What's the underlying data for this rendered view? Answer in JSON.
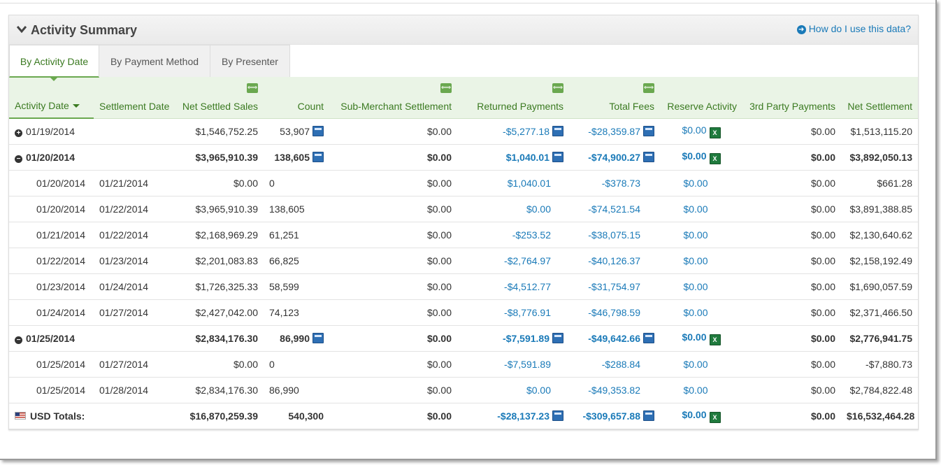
{
  "panel": {
    "title": "Activity Summary",
    "help_link": "How do I use this data?"
  },
  "tabs": [
    {
      "label": "By Activity Date",
      "active": true
    },
    {
      "label": "By Payment Method",
      "active": false
    },
    {
      "label": "By Presenter",
      "active": false
    }
  ],
  "columns": {
    "activity_date": "Activity Date",
    "settlement_date": "Settlement Date",
    "net_settled_sales": "Net Settled Sales",
    "count": "Count",
    "sub_merchant_settlement": "Sub-Merchant Settlement",
    "returned_payments": "Returned Payments",
    "total_fees": "Total Fees",
    "reserve_activity": "Reserve Activity",
    "third_party_payments": "3rd Party Payments",
    "net_settlement": "Net Settlement"
  },
  "rows": [
    {
      "toggle": "+",
      "activity": "01/19/2014",
      "settlement": "",
      "sales": "$1,546,752.25",
      "count": "53,907",
      "sub": "$0.00",
      "returned": "-$5,277.18",
      "fees": "-$28,359.87",
      "reserve": "$0.00",
      "third": "$0.00",
      "net": "$1,513,115.20"
    },
    {
      "toggle": "−",
      "activity": "01/20/2014",
      "settlement": "",
      "sales": "$3,965,910.39",
      "count": "138,605",
      "sub": "$0.00",
      "returned": "$1,040.01",
      "fees": "-$74,900.27",
      "reserve": "$0.00",
      "third": "$0.00",
      "net": "$3,892,050.13"
    },
    {
      "toggle": "",
      "activity": "01/20/2014",
      "settlement": "01/21/2014",
      "sales": "$0.00",
      "count": "0",
      "sub": "$0.00",
      "returned": "$1,040.01",
      "fees": "-$378.73",
      "reserve": "$0.00",
      "third": "$0.00",
      "net": "$661.28"
    },
    {
      "toggle": "",
      "activity": "01/20/2014",
      "settlement": "01/22/2014",
      "sales": "$3,965,910.39",
      "count": "138,605",
      "sub": "$0.00",
      "returned": "$0.00",
      "fees": "-$74,521.54",
      "reserve": "$0.00",
      "third": "$0.00",
      "net": "$3,891,388.85"
    },
    {
      "toggle": "",
      "activity": "01/21/2014",
      "settlement": "01/22/2014",
      "sales": "$2,168,969.29",
      "count": "61,251",
      "sub": "$0.00",
      "returned": "-$253.52",
      "fees": "-$38,075.15",
      "reserve": "$0.00",
      "third": "$0.00",
      "net": "$2,130,640.62"
    },
    {
      "toggle": "",
      "activity": "01/22/2014",
      "settlement": "01/23/2014",
      "sales": "$2,201,083.83",
      "count": "66,825",
      "sub": "$0.00",
      "returned": "-$2,764.97",
      "fees": "-$40,126.37",
      "reserve": "$0.00",
      "third": "$0.00",
      "net": "$2,158,192.49"
    },
    {
      "toggle": "",
      "activity": "01/23/2014",
      "settlement": "01/24/2014",
      "sales": "$1,726,325.33",
      "count": "58,599",
      "sub": "$0.00",
      "returned": "-$4,512.77",
      "fees": "-$31,754.97",
      "reserve": "$0.00",
      "third": "$0.00",
      "net": "$1,690,057.59"
    },
    {
      "toggle": "",
      "activity": "01/24/2014",
      "settlement": "01/27/2014",
      "sales": "$2,427,042.00",
      "count": "74,123",
      "sub": "$0.00",
      "returned": "-$8,776.91",
      "fees": "-$46,798.59",
      "reserve": "$0.00",
      "third": "$0.00",
      "net": "$2,371,466.50"
    },
    {
      "toggle": "−",
      "activity": "01/25/2014",
      "settlement": "",
      "sales": "$2,834,176.30",
      "count": "86,990",
      "sub": "$0.00",
      "returned": "-$7,591.89",
      "fees": "-$49,642.66",
      "reserve": "$0.00",
      "third": "$0.00",
      "net": "$2,776,941.75"
    },
    {
      "toggle": "",
      "activity": "01/25/2014",
      "settlement": "01/27/2014",
      "sales": "$0.00",
      "count": "0",
      "sub": "$0.00",
      "returned": "-$7,591.89",
      "fees": "-$288.84",
      "reserve": "$0.00",
      "third": "$0.00",
      "net": "-$7,880.73"
    },
    {
      "toggle": "",
      "activity": "01/25/2014",
      "settlement": "01/28/2014",
      "sales": "$2,834,176.30",
      "count": "86,990",
      "sub": "$0.00",
      "returned": "$0.00",
      "fees": "-$49,353.82",
      "reserve": "$0.00",
      "third": "$0.00",
      "net": "$2,784,822.48"
    }
  ],
  "totals": {
    "label": "USD Totals:",
    "sales": "$16,870,259.39",
    "count": "540,300",
    "sub": "$0.00",
    "returned": "-$28,137.23",
    "fees": "-$309,657.88",
    "reserve": "$0.00",
    "third": "$0.00",
    "net": "$16,532,464.28"
  },
  "icons": {
    "csv": "csv-export-icon",
    "xls": "excel-export-icon",
    "expand_column": "expand-column-icon"
  },
  "colors": {
    "accent_green": "#3b7a21",
    "link_blue": "#1a7ab8",
    "header_bg": "#eaf4e6"
  }
}
